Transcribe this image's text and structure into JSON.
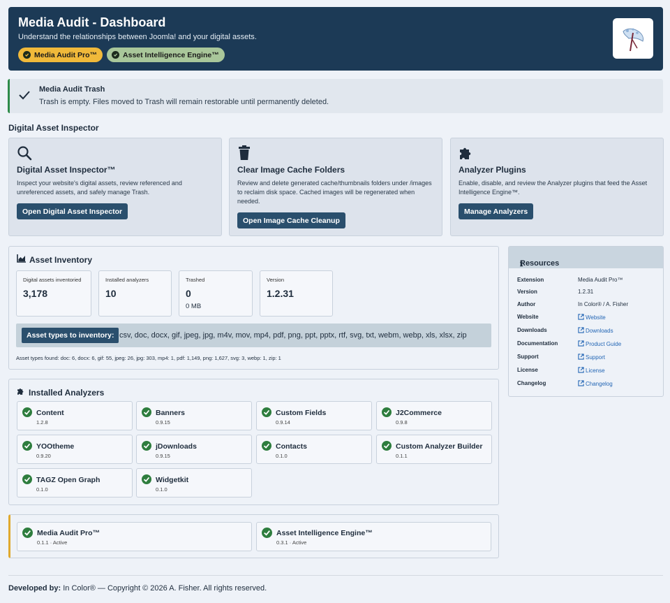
{
  "header": {
    "title": "Media Audit - Dashboard",
    "subtitle": "Understand the relationships between Joomla! and your digital assets.",
    "badges": [
      {
        "label": "Media Audit Pro™",
        "color": "#f0b93a"
      },
      {
        "label": "Asset Intelligence Engine™",
        "color": "#a9c79a"
      }
    ]
  },
  "trash": {
    "title": "Media Audit Trash",
    "message": "Trash is empty. Files moved to Trash will remain restorable until permanently deleted."
  },
  "section_title": "Digital Asset Inspector",
  "cards": [
    {
      "icon": "search-icon",
      "title": "Digital Asset Inspector™",
      "desc": "Inspect your website's digital assets, review referenced and unreferenced assets, and safely manage Trash.",
      "button": "Open Digital Asset Inspector"
    },
    {
      "icon": "trash-icon",
      "title": "Clear Image Cache Folders",
      "desc": "Review and delete generated cache/thumbnails folders under /images to reclaim disk space. Cached images will be regenerated when needed.",
      "button": "Open Image Cache Cleanup"
    },
    {
      "icon": "puzzle-icon",
      "title": "Analyzer Plugins",
      "desc": "Enable, disable, and review the Analyzer plugins that feed the Asset Intelligence Engine™.",
      "button": "Manage Analyzers"
    }
  ],
  "inventory": {
    "title": "Asset Inventory",
    "stats": [
      {
        "label": "Digital assets inventoried",
        "value": "3,178",
        "extra": ""
      },
      {
        "label": "Installed analyzers",
        "value": "10",
        "extra": ""
      },
      {
        "label": "Trashed",
        "value": "0",
        "extra": "0 MB"
      },
      {
        "label": "Version",
        "value": "1.2.31",
        "extra": ""
      }
    ],
    "types_label": "Asset types to inventory:",
    "types_list": "csv, doc, docx, gif, jpeg, jpg, m4v, mov, mp4, pdf, png, ppt, pptx, rtf, svg, txt, webm, webp, xls, xlsx, zip",
    "found": "Asset types found: doc: 6, docx: 6, gif: 55, jpeg: 26, jpg: 303, mp4: 1, pdf: 1,149, png: 1,627, svg: 3, webp: 1, zip: 1"
  },
  "analyzers": {
    "title": "Installed Analyzers",
    "items": [
      {
        "name": "Content",
        "version": "1.2.8"
      },
      {
        "name": "Banners",
        "version": "0.9.15"
      },
      {
        "name": "Custom Fields",
        "version": "0.9.14"
      },
      {
        "name": "J2Commerce",
        "version": "0.9.8"
      },
      {
        "name": "YOOtheme",
        "version": "0.9.20"
      },
      {
        "name": "jDownloads",
        "version": "0.9.15"
      },
      {
        "name": "Contacts",
        "version": "0.1.0"
      },
      {
        "name": "Custom Analyzer Builder",
        "version": "0.1.1"
      },
      {
        "name": "TAGZ Open Graph",
        "version": "0.1.0"
      },
      {
        "name": "Widgetkit",
        "version": "0.1.0"
      }
    ]
  },
  "licenses": [
    {
      "name": "Media Audit Pro™",
      "status": "0.1.1 · Active"
    },
    {
      "name": "Asset Intelligence Engine™",
      "status": "0.3.1 · Active"
    }
  ],
  "resources": {
    "title": "Resources",
    "rows": [
      {
        "key": "Extension",
        "value": "Media Audit Pro™",
        "link": false
      },
      {
        "key": "Version",
        "value": "1.2.31",
        "link": false
      },
      {
        "key": "Author",
        "value": "In Color® / A. Fisher",
        "link": false
      },
      {
        "key": "Website",
        "value": "Website",
        "link": true
      },
      {
        "key": "Downloads",
        "value": "Downloads",
        "link": true
      },
      {
        "key": "Documentation",
        "value": "Product Guide",
        "link": true
      },
      {
        "key": "Support",
        "value": "Support",
        "link": true
      },
      {
        "key": "License",
        "value": "License",
        "link": true
      },
      {
        "key": "Changelog",
        "value": "Changelog",
        "link": true
      }
    ]
  },
  "footer": {
    "label": "Developed by:",
    "text": "In Color® — Copyright © 2026 A. Fisher. All rights reserved."
  }
}
